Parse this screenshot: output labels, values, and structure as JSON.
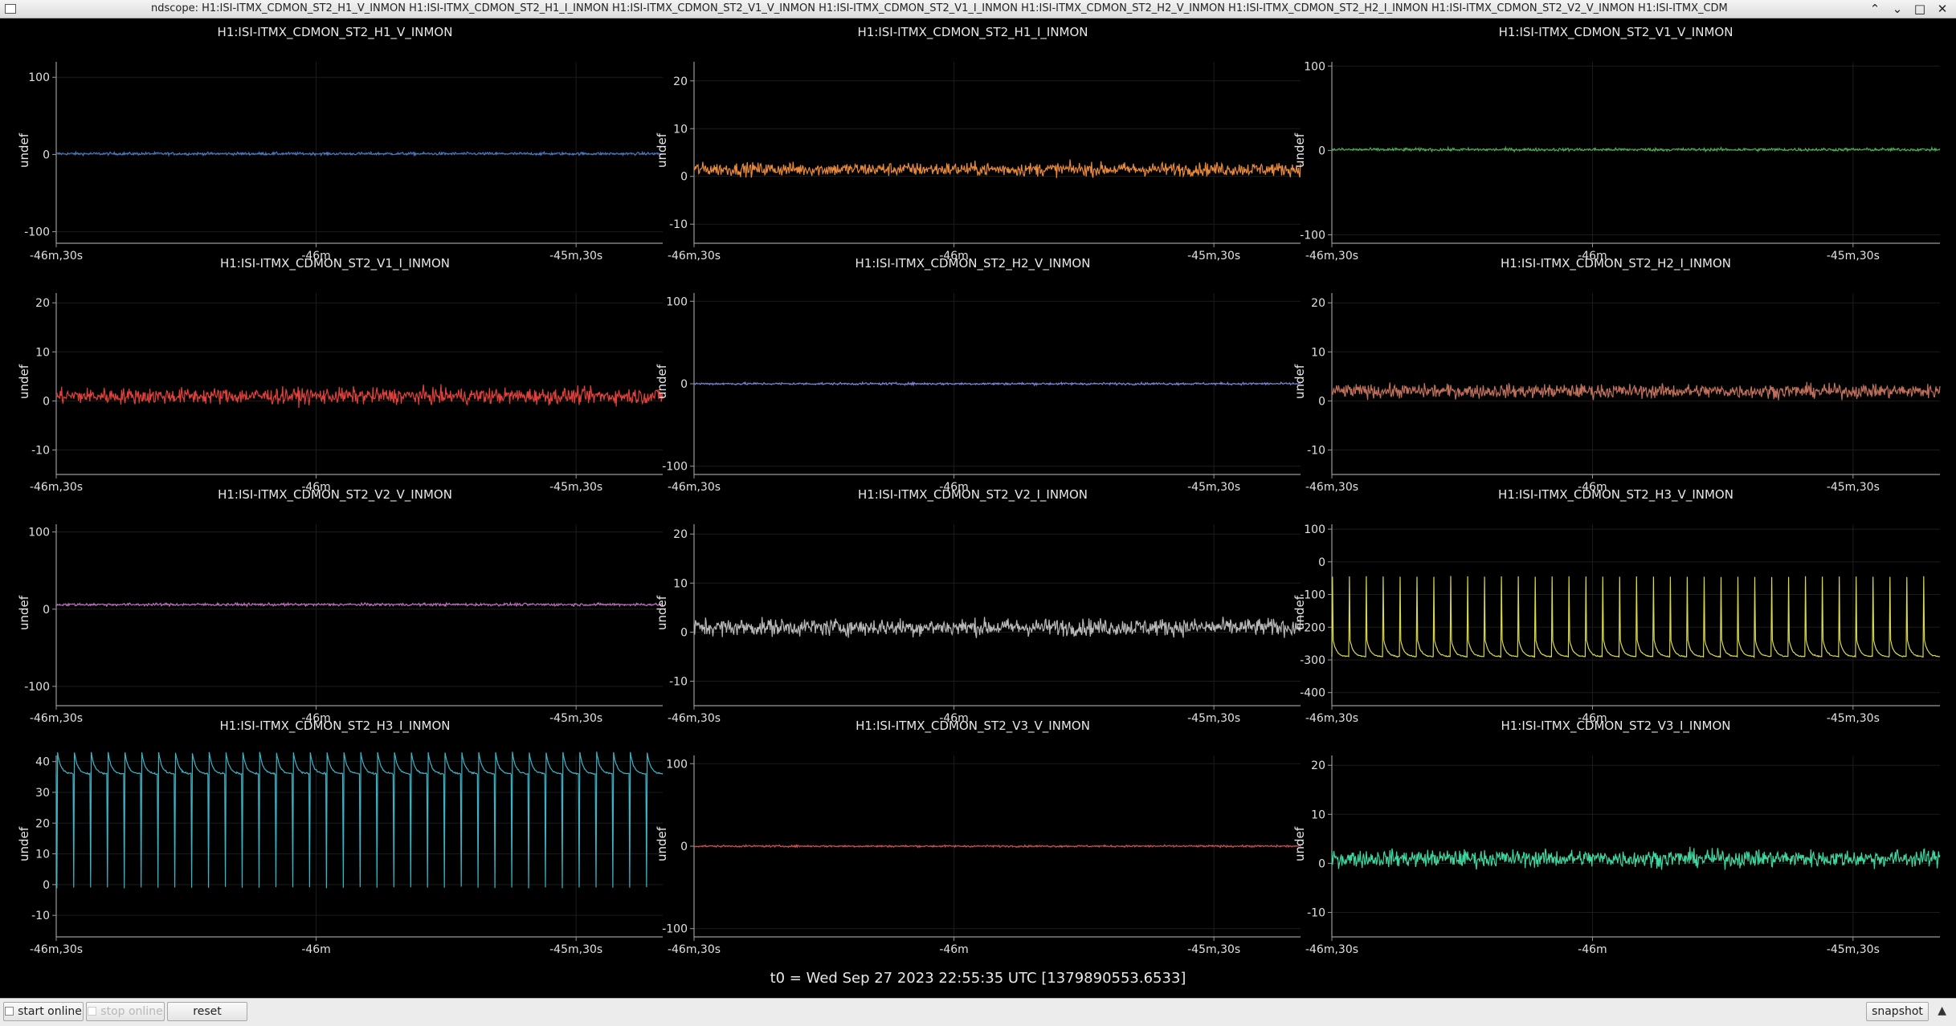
{
  "window": {
    "title": "ndscope: H1:ISI-ITMX_CDMON_ST2_H1_V_INMON H1:ISI-ITMX_CDMON_ST2_H1_I_INMON H1:ISI-ITMX_CDMON_ST2_V1_V_INMON H1:ISI-ITMX_CDMON_ST2_V1_I_INMON H1:ISI-ITMX_CDMON_ST2_H2_V_INMON H1:ISI-ITMX_CDMON_ST2_H2_I_INMON H1:ISI-ITMX_CDMON_ST2_V2_V_INMON H1:ISI-ITMX_CDM",
    "controls": [
      "minimize-icon",
      "restore-icon",
      "maximize-icon",
      "close-icon"
    ],
    "control_glyphs": [
      "⌃",
      "⌄",
      "□",
      "✕"
    ]
  },
  "t0_label": "t0 = Wed Sep 27 2023 22:55:35 UTC [1379890553.6533]",
  "buttons": {
    "start_online": "start online",
    "stop_online": "stop online",
    "reset": "reset",
    "snapshot": "snapshot",
    "expand_glyph": "▲"
  },
  "x_axis": {
    "range": [
      -2790,
      -2720
    ],
    "ticks": [
      -2790,
      -2760,
      -2730
    ],
    "tick_labels": [
      "-46m,30s",
      "-46m",
      "-45m,30s"
    ]
  },
  "chart_data": [
    {
      "type": "line",
      "title": "H1:ISI-ITMX_CDMON_ST2_H1_V_INMON",
      "ylabel": "undef",
      "ylim": [
        -115,
        120
      ],
      "yticks": [
        -100,
        0,
        100
      ],
      "color": "#4a78c2",
      "signal": "noise",
      "mean": 1,
      "amp": 1.5
    },
    {
      "type": "line",
      "title": "H1:ISI-ITMX_CDMON_ST2_H1_I_INMON",
      "ylabel": "undef",
      "ylim": [
        -14,
        24
      ],
      "yticks": [
        -10,
        0,
        10,
        20
      ],
      "color": "#e8893a",
      "signal": "noise",
      "mean": 1.5,
      "amp": 1.2
    },
    {
      "type": "line",
      "title": "H1:ISI-ITMX_CDMON_ST2_V1_V_INMON",
      "ylabel": "undef",
      "ylim": [
        -110,
        105
      ],
      "yticks": [
        -100,
        0,
        100
      ],
      "color": "#4caf50",
      "signal": "noise",
      "mean": 1,
      "amp": 1.5
    },
    {
      "type": "line",
      "title": "H1:ISI-ITMX_CDMON_ST2_V1_I_INMON",
      "ylabel": "undef",
      "ylim": [
        -15,
        22
      ],
      "yticks": [
        -10,
        0,
        10,
        20
      ],
      "color": "#e0403a",
      "signal": "noise",
      "mean": 1,
      "amp": 1.4
    },
    {
      "type": "line",
      "title": "H1:ISI-ITMX_CDMON_ST2_H2_V_INMON",
      "ylabel": "undef",
      "ylim": [
        -110,
        110
      ],
      "yticks": [
        -100,
        0,
        100
      ],
      "color": "#7b82d8",
      "signal": "noise",
      "mean": 0,
      "amp": 1.2
    },
    {
      "type": "line",
      "title": "H1:ISI-ITMX_CDMON_ST2_H2_I_INMON",
      "ylabel": "undef",
      "ylim": [
        -15,
        22
      ],
      "yticks": [
        -10,
        0,
        10,
        20
      ],
      "color": "#c0705a",
      "signal": "noise",
      "mean": 2,
      "amp": 1.2
    },
    {
      "type": "line",
      "title": "H1:ISI-ITMX_CDMON_ST2_V2_V_INMON",
      "ylabel": "undef",
      "ylim": [
        -125,
        110
      ],
      "yticks": [
        -100,
        0,
        100
      ],
      "color": "#c070c0",
      "signal": "noise",
      "mean": 6,
      "amp": 1.5
    },
    {
      "type": "line",
      "title": "H1:ISI-ITMX_CDMON_ST2_V2_I_INMON",
      "ylabel": "undef",
      "ylim": [
        -15,
        22
      ],
      "yticks": [
        -10,
        0,
        10,
        20
      ],
      "color": "#b8b8b8",
      "signal": "noise",
      "mean": 1,
      "amp": 1.5
    },
    {
      "type": "line",
      "title": "H1:ISI-ITMX_CDMON_ST2_H3_V_INMON",
      "ylabel": "undef",
      "ylim": [
        -440,
        115
      ],
      "yticks": [
        -400,
        -300,
        -200,
        -100,
        0,
        100
      ],
      "color": "#d8d84a",
      "signal": "spikes_up",
      "base": -290,
      "peak": -45,
      "recover": -240,
      "spikes": 36
    },
    {
      "type": "line",
      "title": "H1:ISI-ITMX_CDMON_ST2_H3_I_INMON",
      "ylabel": "undef",
      "ylim": [
        -17,
        42
      ],
      "yticks": [
        -10,
        0,
        10,
        20,
        30,
        40
      ],
      "color": "#3ab4c8",
      "signal": "spikes_down",
      "base": 36,
      "peak": -1,
      "recover": 43,
      "spikes": 36
    },
    {
      "type": "line",
      "title": "H1:ISI-ITMX_CDMON_ST2_V3_V_INMON",
      "ylabel": "undef",
      "ylim": [
        -110,
        110
      ],
      "yticks": [
        -100,
        0,
        100
      ],
      "color": "#d05050",
      "signal": "noise",
      "mean": 0,
      "amp": 1.0
    },
    {
      "type": "line",
      "title": "H1:ISI-ITMX_CDMON_ST2_V3_I_INMON",
      "ylabel": "undef",
      "ylim": [
        -15,
        22
      ],
      "yticks": [
        -10,
        0,
        10,
        20
      ],
      "color": "#3ed6a0",
      "signal": "noise",
      "mean": 1,
      "amp": 1.5
    }
  ]
}
